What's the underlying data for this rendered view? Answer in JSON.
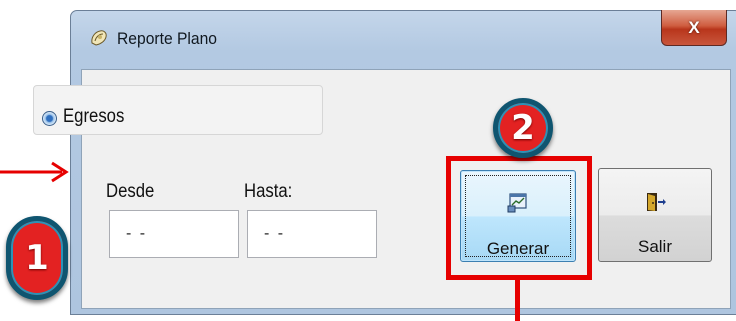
{
  "window": {
    "title": "Reporte Plano",
    "close_label": "X"
  },
  "filter": {
    "option_label": "Egresos",
    "option_selected": true
  },
  "dates": {
    "from_label": "Desde",
    "from_value": "- -",
    "to_label": "Hasta:",
    "to_value": "- -"
  },
  "buttons": {
    "generate_label": "Generar",
    "exit_label": "Salir"
  },
  "annotations": {
    "step_1": "1",
    "step_2": "2",
    "highlight_color": "#e60000",
    "arrow_color": "#e60000"
  },
  "icons": {
    "app": "app-icon",
    "generate": "report-chart-icon",
    "exit": "exit-door-icon"
  }
}
